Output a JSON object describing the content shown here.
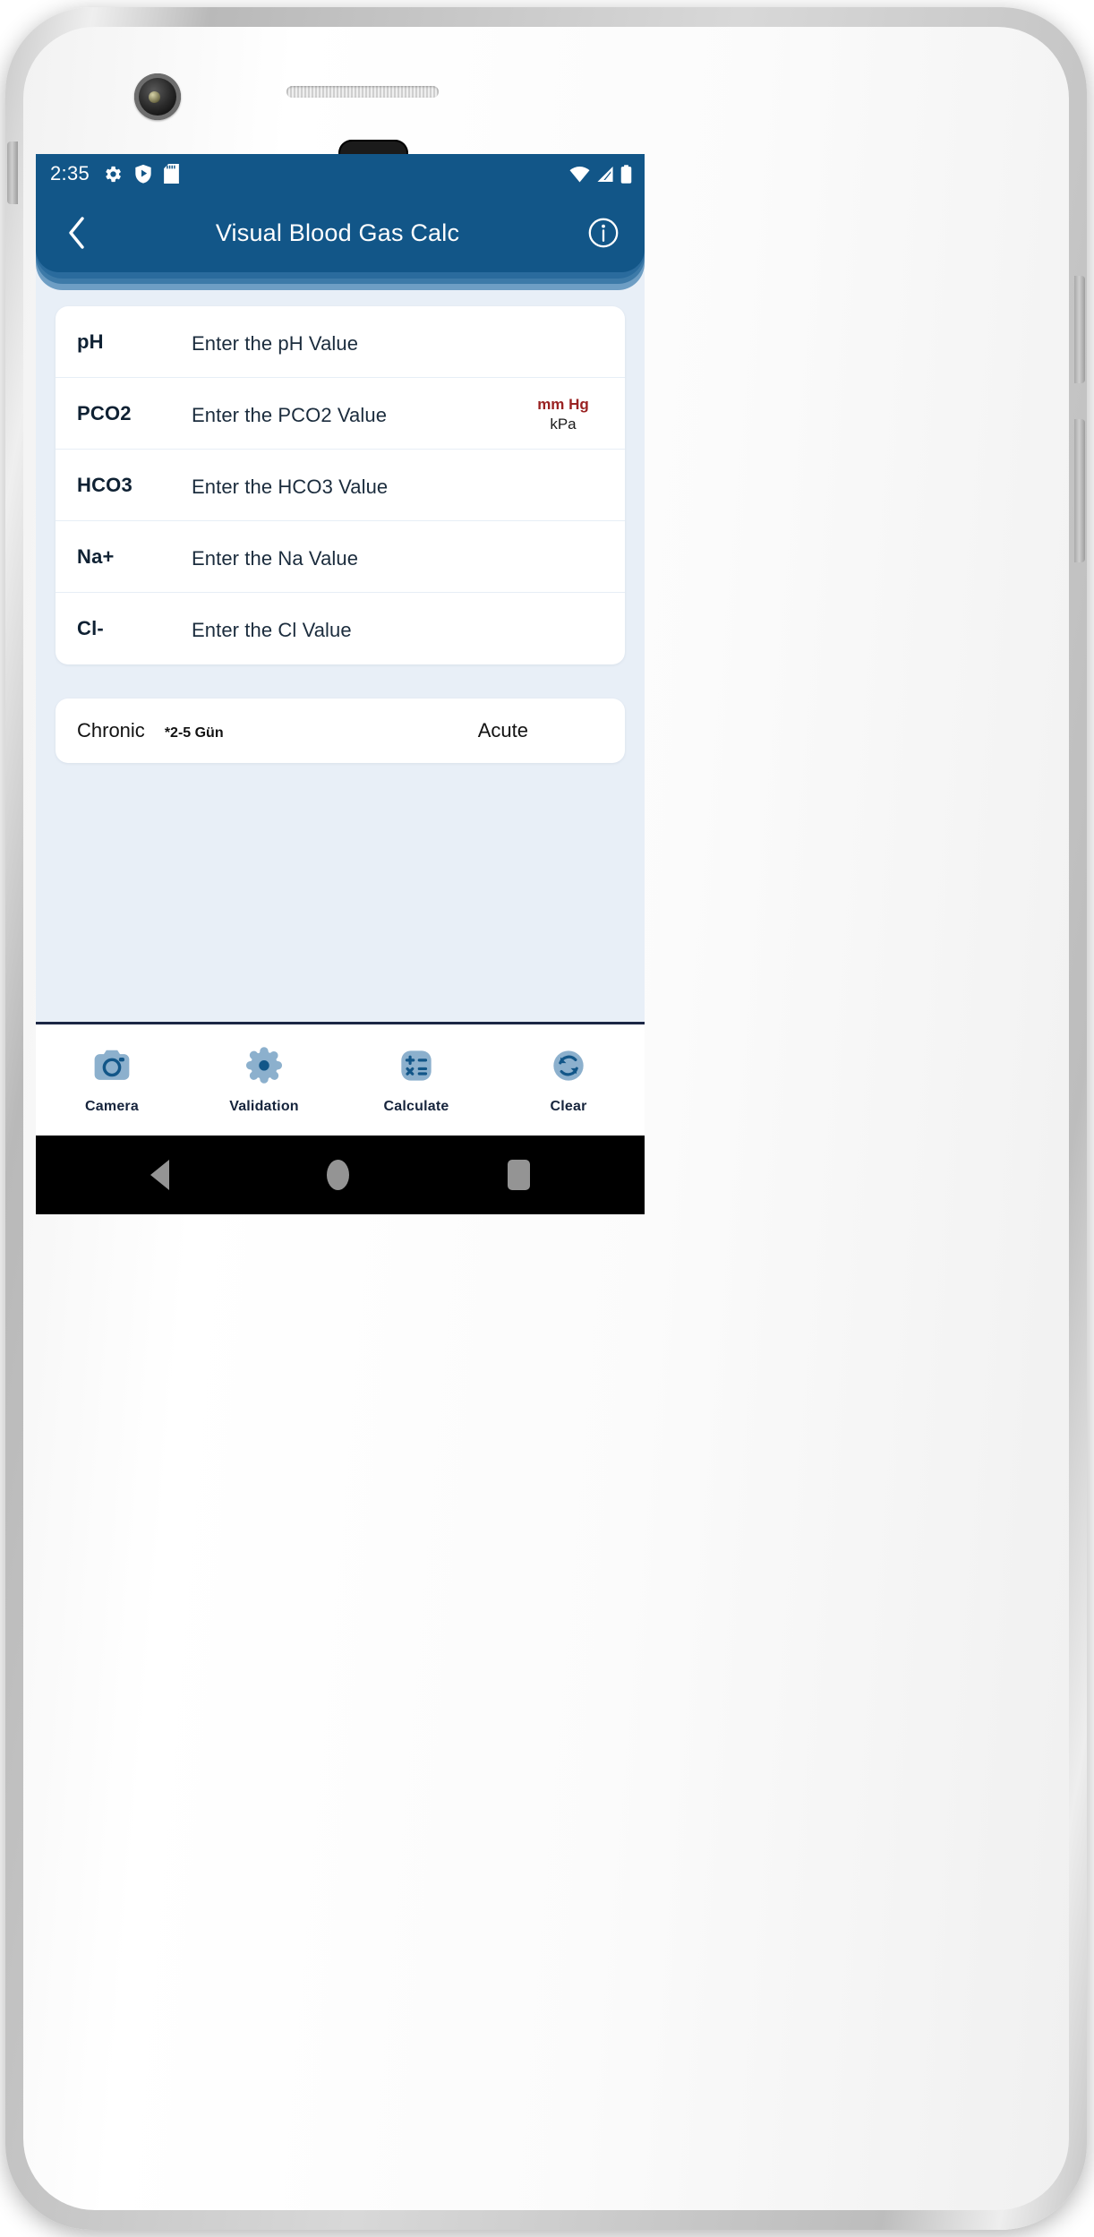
{
  "device": {
    "camera_icon": "front-camera",
    "speaker_icon": "earpiece-speaker"
  },
  "status_bar": {
    "time": "2:35",
    "left_icons": [
      "gear-icon",
      "play-protect-shield-icon",
      "sd-card-icon"
    ],
    "right_icons": [
      "wifi-icon",
      "cellular-signal-icon",
      "battery-icon"
    ]
  },
  "app_bar": {
    "back_icon": "back-chevron-icon",
    "title": "Visual Blood Gas Calc",
    "info_icon": "info-circle-icon",
    "background_color": "#125688"
  },
  "form": {
    "fields": [
      {
        "label": "pH",
        "placeholder": "Enter the pH Value",
        "has_units": false
      },
      {
        "label": "PCO2",
        "placeholder": "Enter the PCO2 Value",
        "has_units": true,
        "units": [
          {
            "text": "mm Hg",
            "selected": true
          },
          {
            "text": "kPa",
            "selected": false
          }
        ]
      },
      {
        "label": "HCO3",
        "placeholder": "Enter the HCO3 Value",
        "has_units": false
      },
      {
        "label": "Na+",
        "placeholder": "Enter the Na Value",
        "has_units": false
      },
      {
        "label": "Cl-",
        "placeholder": "Enter the Cl Value",
        "has_units": false
      }
    ]
  },
  "mode_selector": {
    "chronic_label": "Chronic",
    "note": "*2-5 Gün",
    "acute_label": "Acute"
  },
  "bottom_toolbar": {
    "items": [
      {
        "label": "Camera",
        "icon": "camera-icon"
      },
      {
        "label": "Validation",
        "icon": "gear-icon"
      },
      {
        "label": "Calculate",
        "icon": "calculator-icon"
      },
      {
        "label": "Clear",
        "icon": "refresh-icon"
      }
    ],
    "icon_fill": "#8cb0cd",
    "icon_accent": "#125688"
  },
  "nav_bar": {
    "back_icon": "nav-back-triangle-icon",
    "home_icon": "nav-home-circle-icon",
    "recents_icon": "nav-recents-square-icon"
  },
  "colors": {
    "accent_red": "#9a2222",
    "primary_blue": "#125688",
    "screen_background": "#e8eff7"
  }
}
